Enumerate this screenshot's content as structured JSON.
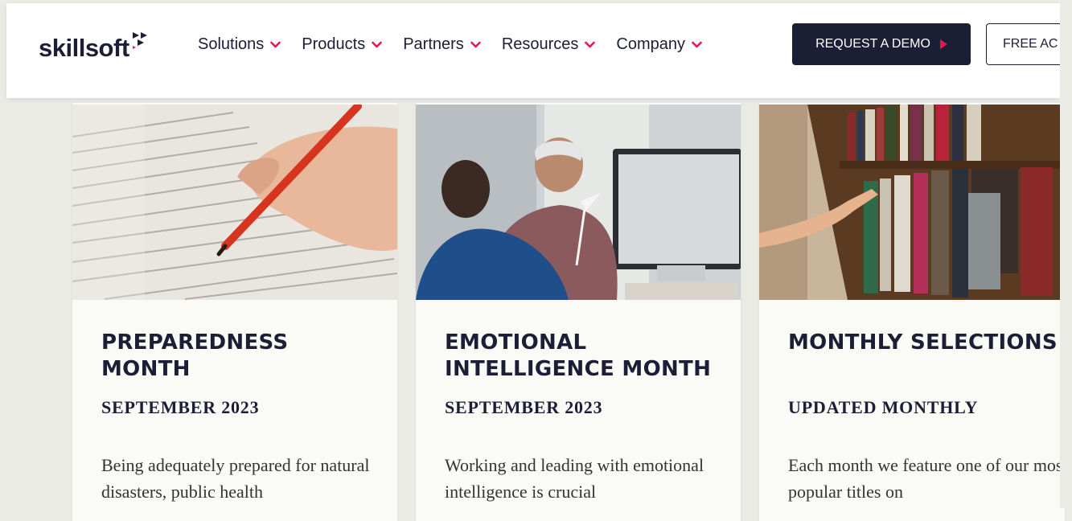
{
  "brand": {
    "name": "skillsoft",
    "accent": "#e8174b",
    "navy": "#1c1e36"
  },
  "nav": [
    {
      "label": "Solutions"
    },
    {
      "label": "Products"
    },
    {
      "label": "Partners"
    },
    {
      "label": "Resources"
    },
    {
      "label": "Company"
    }
  ],
  "cta": {
    "demo": "REQUEST A DEMO",
    "free": "FREE AC"
  },
  "cards": [
    {
      "title": "PREPAREDNESS MONTH",
      "subtitle": "SEPTEMBER 2023",
      "desc": "Being adequately prepared for natural disasters, public health",
      "image": "hand-writing-with-red-pen"
    },
    {
      "title": "EMOTIONAL INTELLIGENCE MONTH",
      "subtitle": "SEPTEMBER 2023",
      "desc": "Working and leading with emotional intelligence is crucial",
      "image": "two-men-talking-at-desk"
    },
    {
      "title": "MONTHLY SELECTIONS",
      "subtitle": "UPDATED MONTHLY",
      "desc": "Each month we feature one of our most popular titles on",
      "image": "hand-pulling-book-from-library-shelf"
    }
  ]
}
